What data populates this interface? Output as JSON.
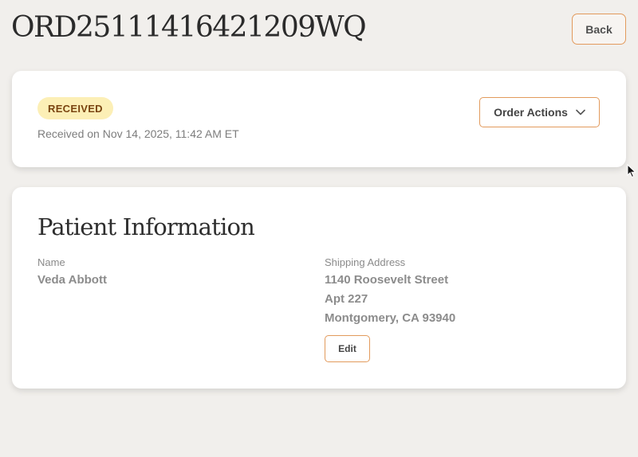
{
  "header": {
    "order_id": "ORD25111416421209WQ",
    "back_label": "Back"
  },
  "status": {
    "badge": "RECEIVED",
    "received_text": "Received on Nov 14, 2025, 11:42 AM ET",
    "order_actions_label": "Order Actions",
    "badge_bg_color": "#fcefb6",
    "badge_text_color": "#7a4410",
    "accent_border_color": "#e29a5c"
  },
  "patient": {
    "section_title": "Patient Information",
    "name_label": "Name",
    "name_value": "Veda Abbott",
    "address_label": "Shipping Address",
    "address_line1": "1140 Roosevelt Street",
    "address_line2": "Apt 227",
    "address_line3": "Montgomery, CA 93940",
    "edit_label": "Edit"
  },
  "icons": {
    "dropdown": "chevron-down-icon",
    "pointer": "mouse-cursor-icon"
  }
}
